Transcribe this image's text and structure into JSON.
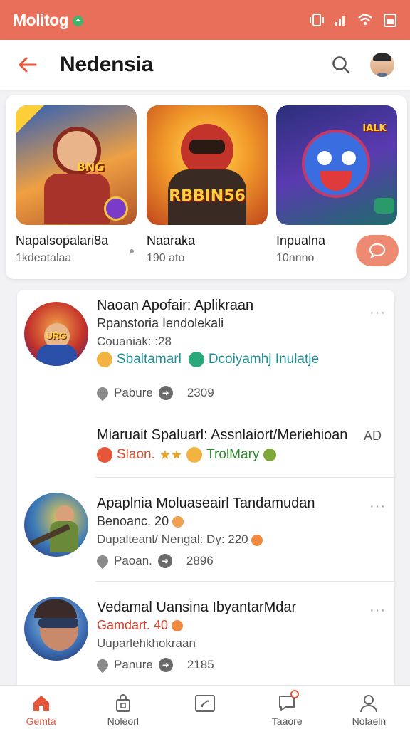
{
  "status": {
    "app_name": "Molitog",
    "badge": "✦"
  },
  "appbar": {
    "title": "Nedensia"
  },
  "featured": [
    {
      "title": "Napalsopalari8a",
      "sub": "1kdeatalaa",
      "logo": "BNG"
    },
    {
      "title": "Naaraka",
      "sub": "190 ato",
      "logo": "RBBIN56"
    },
    {
      "title": "Inpualna",
      "sub": "10nnno",
      "logo": "IALK"
    }
  ],
  "list": [
    {
      "title": "Naoan Apofair: Aplikraan",
      "subtitle": "Rpanstoria Iendolekali",
      "meta": "Couaniak: :28",
      "tag1": "Sbaltamarl",
      "tag2": "Dcoiyamhj Inulatje",
      "stat_label": "Pabure",
      "stat_value": "2309",
      "logo": "URG"
    },
    {
      "title": "Miaruait Spaluarl: Assnlaiort/Meriehioan",
      "ad": "AD",
      "tag1": "Slaon.",
      "tag2": "TrolMary"
    },
    {
      "title": "Apaplnia Moluaseairl Tandamudan",
      "subtitle": "Benoanc. 20",
      "meta": "Dupalteanl/ Nengal: Dy: 220",
      "stat_label": "Paoan.",
      "stat_value": "2896"
    },
    {
      "title": "Vedamal Uansina IbyantarMdar",
      "subtitle": "Gamdart. 40",
      "meta": "Uuparlehkhokraan",
      "stat_label": "Panure",
      "stat_value": "2185"
    }
  ],
  "nav": [
    {
      "label": "Gemta",
      "icon": "home-icon",
      "active": true
    },
    {
      "label": "Noleorl",
      "icon": "bag-icon"
    },
    {
      "label": "",
      "icon": "pen-box-icon"
    },
    {
      "label": "Taaore",
      "icon": "chat-icon"
    },
    {
      "label": "Nolaeln",
      "icon": "profile-icon"
    }
  ],
  "colors": {
    "accent": "#e8563a",
    "status_bar": "#e8705a",
    "tag_teal": "#1f8e94",
    "tag_orange": "#d9502e",
    "tag_green": "#2a8a2a"
  }
}
